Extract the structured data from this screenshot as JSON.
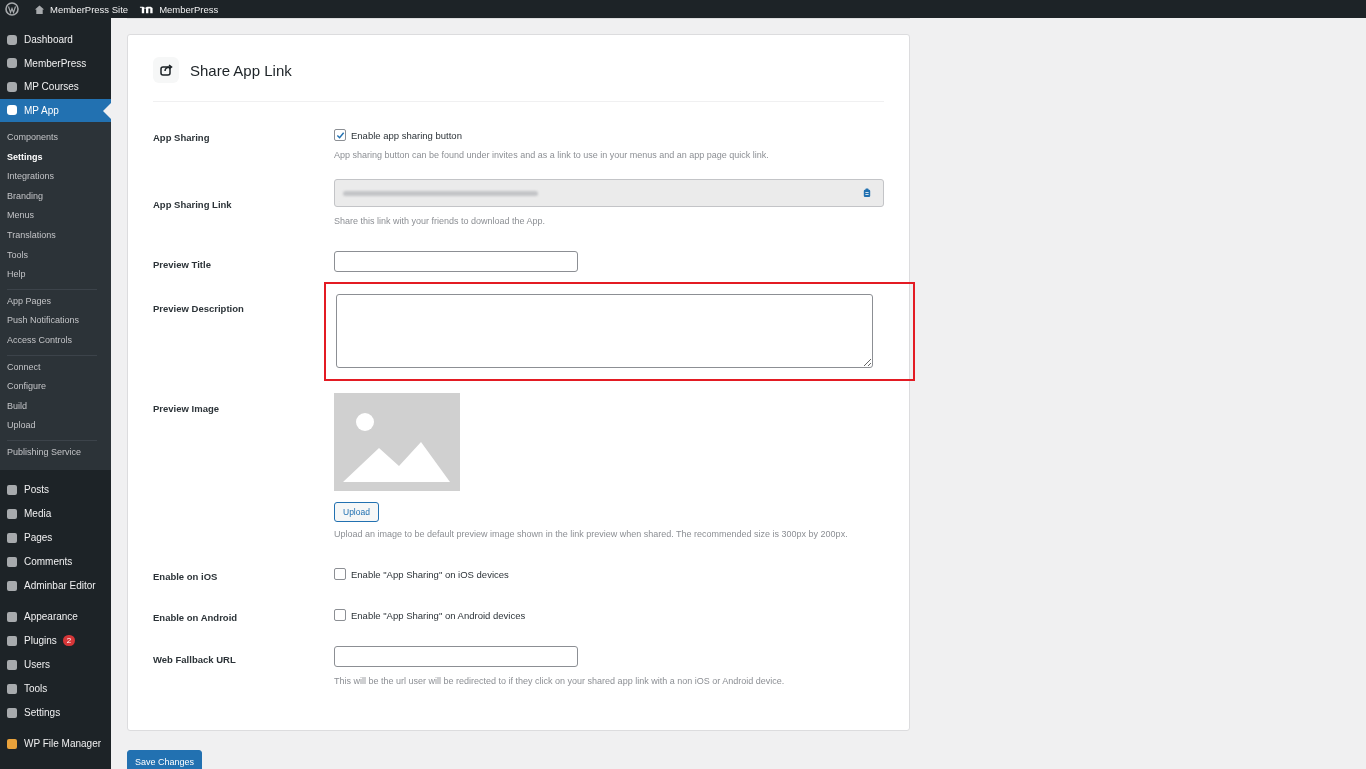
{
  "admin_bar": [
    {
      "label": "MemberPress Site"
    },
    {
      "label": "MemberPress"
    }
  ],
  "sidebar": {
    "top": [
      {
        "label": "Dashboard",
        "selected": false
      },
      {
        "label": "MemberPress",
        "selected": false
      },
      {
        "label": "MP Courses",
        "selected": false
      },
      {
        "label": "MP App",
        "selected": true
      }
    ],
    "submenu": [
      {
        "items": [
          {
            "label": "Components",
            "selected": false
          },
          {
            "label": "Settings",
            "selected": true
          },
          {
            "label": "Integrations",
            "selected": false
          },
          {
            "label": "Branding",
            "selected": false
          },
          {
            "label": "Menus",
            "selected": false
          },
          {
            "label": "Translations",
            "selected": false
          },
          {
            "label": "Tools",
            "selected": false
          },
          {
            "label": "Help",
            "selected": false
          }
        ]
      },
      {
        "items": [
          {
            "label": "App Pages",
            "selected": false
          },
          {
            "label": "Push Notifications",
            "selected": false
          },
          {
            "label": "Access Controls",
            "selected": false
          }
        ]
      },
      {
        "items": [
          {
            "label": "Connect",
            "selected": false
          },
          {
            "label": "Configure",
            "selected": false
          },
          {
            "label": "Build",
            "selected": false
          },
          {
            "label": "Upload",
            "selected": false
          }
        ]
      },
      {
        "items": [
          {
            "label": "Publishing Service",
            "selected": false
          }
        ]
      }
    ],
    "bottom": [
      {
        "label": "Posts"
      },
      {
        "label": "Media"
      },
      {
        "label": "Pages"
      },
      {
        "label": "Comments"
      },
      {
        "label": "Adminbar Editor"
      },
      {
        "label": "Appearance"
      },
      {
        "label": "Plugins",
        "badge": "2"
      },
      {
        "label": "Users"
      },
      {
        "label": "Tools"
      },
      {
        "label": "Settings"
      },
      {
        "label": "WP File Manager"
      }
    ]
  },
  "card": {
    "title": "Share App Link",
    "rows": [
      {
        "kind": "checkbox",
        "label": "App Sharing",
        "option": "Enable app sharing button",
        "checked": true,
        "help": "App sharing button can be found under invites and as a link to use in your menus and an app page quick link."
      },
      {
        "kind": "link",
        "label": "App Sharing Link",
        "help": "Share this link with your friends to download the App."
      },
      {
        "kind": "text",
        "label": "Preview Title"
      },
      {
        "kind": "textarea",
        "label": "Preview Description",
        "highlighted": true
      },
      {
        "label": "Preview Image",
        "button": "Upload",
        "help": "Upload an image to be default preview image shown in the link preview when shared. The recommended size is 300px by 200px."
      },
      {
        "kind": "checkbox",
        "label": "Enable on iOS",
        "option": "Enable \"App Sharing\" on iOS devices",
        "checked": false
      },
      {
        "kind": "checkbox",
        "label": "Enable on Android",
        "option": "Enable \"App Sharing\" on Android devices",
        "checked": false
      },
      {
        "kind": "text",
        "label": "Web Fallback URL",
        "help": "This will be the url user will be redirected to if they click on your shared app link with a non iOS or Android device."
      }
    ]
  },
  "save_button": "Save Changes"
}
